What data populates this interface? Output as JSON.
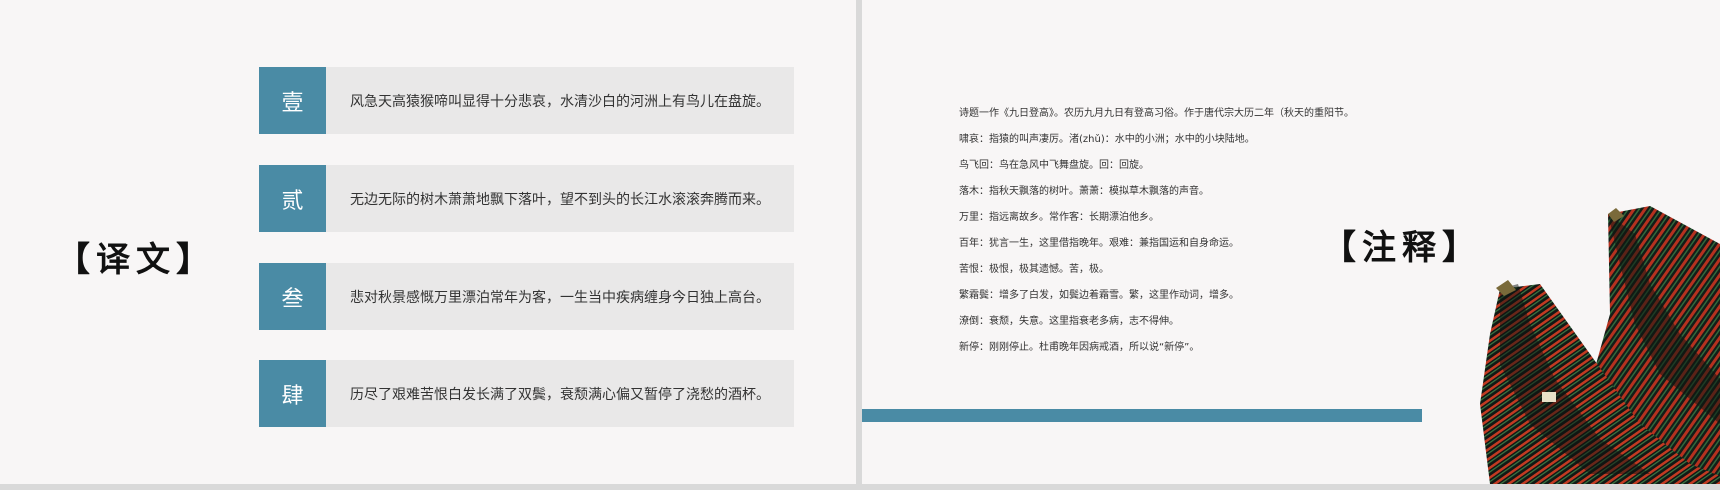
{
  "left_slide": {
    "title": "【译文】",
    "rows": [
      {
        "badge": "壹",
        "text": "风急天高猿猴啼叫显得十分悲哀，水清沙白的河洲上有鸟儿在盘旋。"
      },
      {
        "badge": "贰",
        "text": "无边无际的树木萧萧地飘下落叶，望不到头的长江水滚滚奔腾而来。"
      },
      {
        "badge": "叁",
        "text": "悲对秋景感慨万里漂泊常年为客，一生当中疾病缠身今日独上高台。"
      },
      {
        "badge": "肆",
        "text": "历尽了艰难苦恨白发长满了双鬓，衰颓满心偏又暂停了浇愁的酒杯。"
      }
    ]
  },
  "right_slide": {
    "title": "【注释】",
    "notes": [
      "诗题一作《九日登高》。农历九月九日有登高习俗。作于唐代宗大历二年（秋天的重阳节。",
      "啸哀：指猿的叫声凄厉。渚(zhǔ)：水中的小洲；水中的小块陆地。",
      "鸟飞回：鸟在急风中飞舞盘旋。回：回旋。",
      "落木：指秋天飘落的树叶。萧萧：模拟草木飘落的声音。",
      "万里：指远离故乡。常作客：长期漂泊他乡。",
      "百年：犹言一生，这里借指晚年。艰难：兼指国运和自身命运。",
      "苦恨：极恨，极其遗憾。苦，极。",
      "繁霜鬓：增多了白发，如鬓边着霜雪。繁，这里作动词，增多。",
      "潦倒：衰颓，失意。这里指衰老多病，志不得伸。",
      "新停：刚刚停止。杜甫晚年因病戒酒，所以说“新停”。"
    ]
  },
  "colors": {
    "accent": "#4a8ba5",
    "row_background": "#e9e8e8",
    "slide_background": "#f8f6f6"
  },
  "icons": {
    "building": "temple-eaves-image"
  }
}
